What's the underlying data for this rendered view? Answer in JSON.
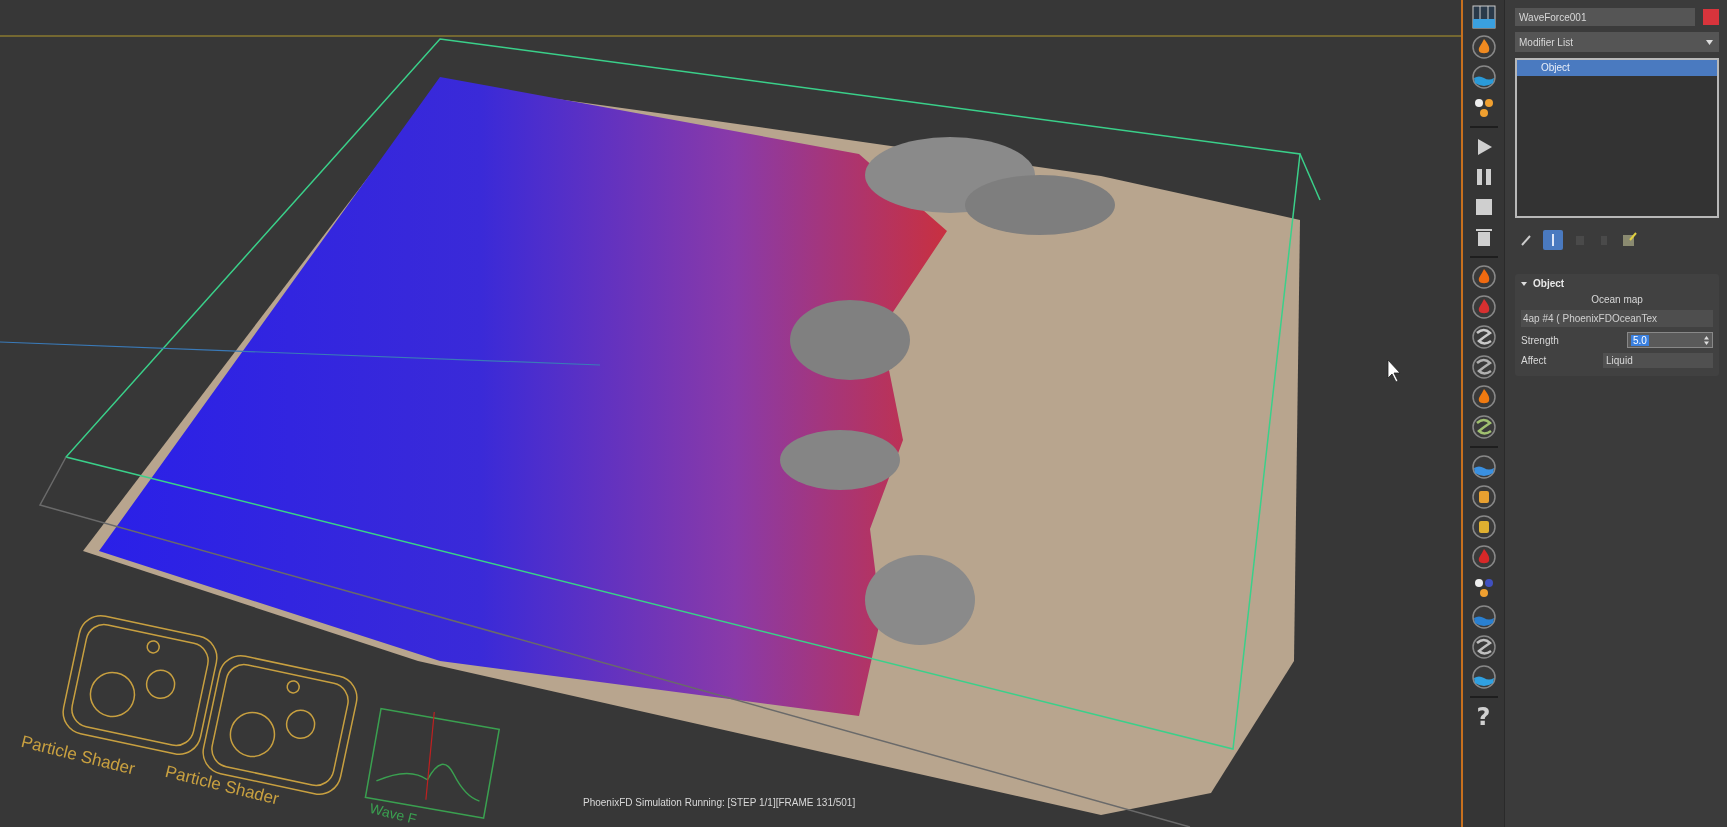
{
  "viewport": {
    "labels": [
      {
        "text": "Particle Shader"
      },
      {
        "text": "Particle Shader"
      }
    ],
    "wave_label": "Wave F",
    "status": "PhoenixFD Simulation Running: [STEP 1/1][FRAME 131/501]"
  },
  "toolbar": {
    "help": "?"
  },
  "panel": {
    "object": {
      "name": "WaveForce001",
      "color": "#d8343c"
    },
    "modifier_dropdown": "Modifier List",
    "stack": [
      {
        "label": "Object",
        "selected": true
      }
    ],
    "rollout": {
      "title": "Object",
      "expanded": true,
      "map_label": "Ocean map",
      "map_button": "4ap #4  ( PhoenixFDOceanTex",
      "strength_label": "Strength",
      "strength_value": "5.0",
      "affect_label": "Affect",
      "affect_value": "Liquid"
    }
  }
}
